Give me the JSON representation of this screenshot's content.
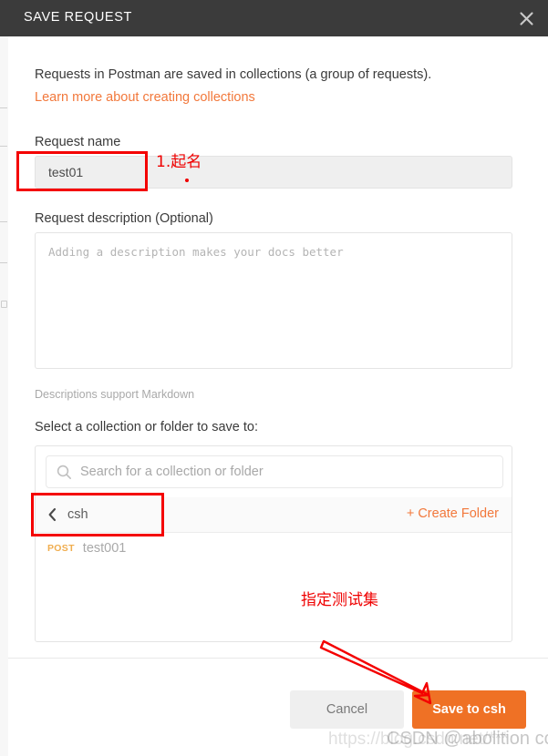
{
  "window": {
    "title": "SAVE REQUEST",
    "close_icon": "close-icon"
  },
  "intro": {
    "text": "Requests in Postman are saved in collections (a group of requests).",
    "link": "Learn more about creating collections"
  },
  "form": {
    "request_name_label": "Request name",
    "request_name_value": "test01",
    "request_name_placeholder": "Request name",
    "request_description_label": "Request description (Optional)",
    "request_description_value": "",
    "request_description_placeholder": "Adding a description makes your docs better",
    "markdown_hint": "Descriptions support Markdown"
  },
  "picker": {
    "label": "Select a collection or folder to save to:",
    "search_placeholder": "Search for a collection or folder",
    "search_value": "",
    "search_icon": "search-icon",
    "back_icon": "chevron-left-icon",
    "breadcrumb": "csh",
    "create_folder": "+ Create Folder",
    "items": [
      {
        "method": "POST",
        "name": "test001"
      }
    ]
  },
  "footer": {
    "cancel_label": "Cancel",
    "save_label": "Save to csh"
  },
  "annotations": [
    {
      "id": "name-note",
      "text": "1.起名"
    },
    {
      "id": "collection-note",
      "text": "指定测试集"
    }
  ],
  "watermarks": {
    "url": "https://blog.csdn.net/***",
    "author": "CSDN @abolition cc"
  },
  "colors": {
    "header_bg": "#3b3b3b",
    "accent_orange": "#ef7125",
    "link_orange": "#f2783b",
    "method_post": "#f0ad4e",
    "annotation_red": "#ef0000"
  }
}
